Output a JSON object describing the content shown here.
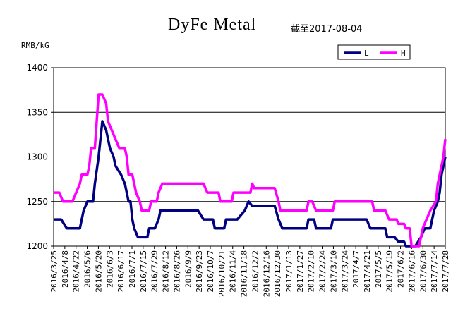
{
  "chart_data": {
    "type": "line",
    "title": "DyFe Metal",
    "date_note": "截至2017-08-04",
    "ylabel": "RMB/kG",
    "ylim": [
      1200,
      1400
    ],
    "yticks": [
      "1200",
      "1250",
      "1300",
      "1350",
      "1400"
    ],
    "grid": true,
    "legend_position": "top-right",
    "x_tick_labels": [
      "2016/3/25",
      "2016/4/8",
      "2016/4/22",
      "2016/5/6",
      "2016/5/20",
      "2016/6/3",
      "2016/6/17",
      "2016/7/1",
      "2016/7/15",
      "2016/7/29",
      "2016/8/12",
      "2016/8/26",
      "2016/9/9",
      "2016/9/23",
      "2016/10/7",
      "2016/10/21",
      "2016/11/4",
      "2016/11/18",
      "2016/12/2",
      "2016/12/16",
      "2016/12/30",
      "2017/1/13",
      "2017/1/27",
      "2017/2/10",
      "2017/2/24",
      "2017/3/10",
      "2017/3/24",
      "2017/4/7",
      "2017/4/21",
      "2017/5/5",
      "2017/5/19",
      "2017/6/2",
      "2017/6/16",
      "2017/6/30",
      "2017/7/14",
      "2017/7/28"
    ],
    "series": [
      {
        "name": "L",
        "color": "#000080",
        "points": [
          [
            0,
            1230
          ],
          [
            4,
            1230
          ],
          [
            7,
            1220
          ],
          [
            14,
            1220
          ],
          [
            15,
            1230
          ],
          [
            16,
            1240
          ],
          [
            18,
            1250
          ],
          [
            21,
            1250
          ],
          [
            22,
            1270
          ],
          [
            24,
            1300
          ],
          [
            26,
            1340
          ],
          [
            28,
            1330
          ],
          [
            30,
            1310
          ],
          [
            32,
            1300
          ],
          [
            33,
            1290
          ],
          [
            36,
            1280
          ],
          [
            38,
            1270
          ],
          [
            39,
            1260
          ],
          [
            40,
            1250
          ],
          [
            41,
            1250
          ],
          [
            42,
            1230
          ],
          [
            43,
            1220
          ],
          [
            45,
            1210
          ],
          [
            50,
            1210
          ],
          [
            51,
            1220
          ],
          [
            54,
            1220
          ],
          [
            56,
            1230
          ],
          [
            57,
            1240
          ],
          [
            74,
            1240
          ],
          [
            77,
            1240
          ],
          [
            80,
            1230
          ],
          [
            85,
            1230
          ],
          [
            86,
            1220
          ],
          [
            91,
            1220
          ],
          [
            92,
            1230
          ],
          [
            98,
            1230
          ],
          [
            102,
            1240
          ],
          [
            104,
            1250
          ],
          [
            106,
            1245
          ],
          [
            118,
            1245
          ],
          [
            120,
            1230
          ],
          [
            122,
            1220
          ],
          [
            135,
            1220
          ],
          [
            136,
            1230
          ],
          [
            139,
            1230
          ],
          [
            140,
            1220
          ],
          [
            148,
            1220
          ],
          [
            149,
            1230
          ],
          [
            167,
            1230
          ],
          [
            169,
            1220
          ],
          [
            177,
            1220
          ],
          [
            178,
            1210
          ],
          [
            182,
            1210
          ],
          [
            184,
            1205
          ],
          [
            187,
            1205
          ],
          [
            188,
            1200
          ],
          [
            193,
            1200
          ],
          [
            196,
            1210
          ],
          [
            198,
            1220
          ],
          [
            201,
            1220
          ],
          [
            202,
            1230
          ],
          [
            203,
            1240
          ],
          [
            205,
            1250
          ],
          [
            206,
            1260
          ],
          [
            207,
            1280
          ],
          [
            209,
            1300
          ]
        ]
      },
      {
        "name": "H",
        "color": "#ff00ff",
        "points": [
          [
            0,
            1260
          ],
          [
            3,
            1260
          ],
          [
            5,
            1250
          ],
          [
            10,
            1250
          ],
          [
            12,
            1260
          ],
          [
            14,
            1270
          ],
          [
            15,
            1280
          ],
          [
            18,
            1280
          ],
          [
            19,
            1290
          ],
          [
            20,
            1310
          ],
          [
            22,
            1310
          ],
          [
            24,
            1370
          ],
          [
            26,
            1370
          ],
          [
            28,
            1360
          ],
          [
            29,
            1340
          ],
          [
            31,
            1330
          ],
          [
            33,
            1320
          ],
          [
            35,
            1310
          ],
          [
            38,
            1310
          ],
          [
            39,
            1300
          ],
          [
            40,
            1280
          ],
          [
            42,
            1280
          ],
          [
            44,
            1260
          ],
          [
            46,
            1250
          ],
          [
            47,
            1240
          ],
          [
            51,
            1240
          ],
          [
            52,
            1250
          ],
          [
            55,
            1250
          ],
          [
            56,
            1260
          ],
          [
            58,
            1270
          ],
          [
            80,
            1270
          ],
          [
            82,
            1260
          ],
          [
            88,
            1260
          ],
          [
            89,
            1250
          ],
          [
            95,
            1250
          ],
          [
            96,
            1260
          ],
          [
            105,
            1260
          ],
          [
            106,
            1270
          ],
          [
            107,
            1265
          ],
          [
            118,
            1265
          ],
          [
            120,
            1250
          ],
          [
            121,
            1240
          ],
          [
            135,
            1240
          ],
          [
            136,
            1250
          ],
          [
            138,
            1250
          ],
          [
            140,
            1240
          ],
          [
            149,
            1240
          ],
          [
            150,
            1250
          ],
          [
            170,
            1250
          ],
          [
            171,
            1240
          ],
          [
            177,
            1240
          ],
          [
            179,
            1230
          ],
          [
            183,
            1230
          ],
          [
            184,
            1225
          ],
          [
            187,
            1225
          ],
          [
            188,
            1220
          ],
          [
            190,
            1220
          ],
          [
            191,
            1200
          ],
          [
            195,
            1200
          ],
          [
            196,
            1210
          ],
          [
            197,
            1220
          ],
          [
            199,
            1230
          ],
          [
            201,
            1240
          ],
          [
            204,
            1250
          ],
          [
            205,
            1270
          ],
          [
            206,
            1280
          ],
          [
            208,
            1300
          ],
          [
            209,
            1320
          ]
        ]
      }
    ]
  }
}
